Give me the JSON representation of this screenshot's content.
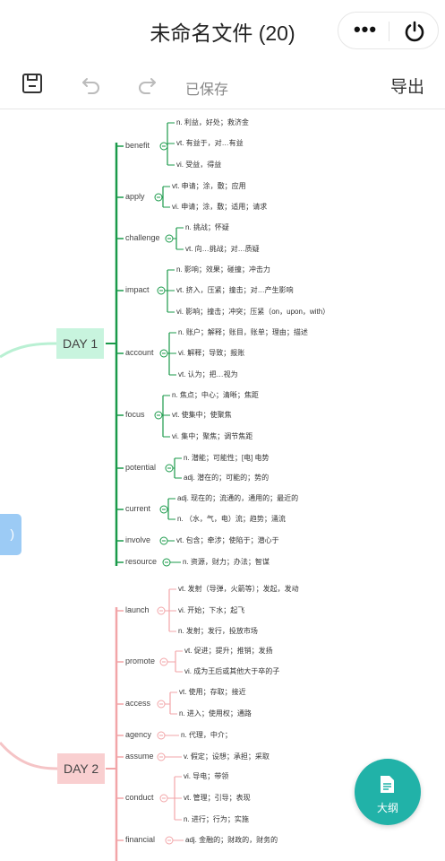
{
  "window": {
    "title": "未命名文件 (20)"
  },
  "toolbar": {
    "saved_label": "已保存",
    "export_label": "导出"
  },
  "fab": {
    "label": "大纲"
  },
  "colors": {
    "day1": "#1a9a4a",
    "day2": "#f2a5a8",
    "teal": "#21b2a8"
  },
  "mindmap": {
    "root_label": ")",
    "days": [
      {
        "label": "DAY 1",
        "words": [
          {
            "word": "benefit",
            "defs": [
              "n. 利益，好处；救济金",
              "vt. 有益于，对…有益",
              "vi. 受益，得益"
            ]
          },
          {
            "word": "apply",
            "defs": [
              "vt. 申请；涂，敷；应用",
              "vi. 申请；涂，敷；适用；请求"
            ]
          },
          {
            "word": "challenge",
            "defs": [
              "n. 挑战；怀疑",
              "vt. 向…挑战；对…质疑"
            ]
          },
          {
            "word": "impact",
            "defs": [
              "n. 影响；效果；碰撞；冲击力",
              "vt. 挤入，压紧；撞击；对…产生影响",
              "vi. 影响；撞击；冲突；压紧（on，upon，with）"
            ]
          },
          {
            "word": "account",
            "defs": [
              "n. 账户；解释；账目，账单；理由；描述",
              "vi. 解释；导致；报账",
              "vt. 认为；把…视为"
            ]
          },
          {
            "word": "focus",
            "defs": [
              "n. 焦点；中心；清晰；焦距",
              "vt. 使集中；使聚焦",
              "vi. 集中；聚焦；调节焦距"
            ]
          },
          {
            "word": "potential",
            "defs": [
              "n. 潜能；可能性；[电] 电势",
              "adj. 潜在的；可能的；势的"
            ]
          },
          {
            "word": "current",
            "defs": [
              "adj. 现在的；流通的，通用的；最近的",
              "n. （水，气，电）流；趋势；涌流"
            ]
          },
          {
            "word": "involve",
            "defs": [
              "vt. 包含；牵涉；使陷于；潜心于"
            ]
          },
          {
            "word": "resource",
            "defs": [
              "n. 资源，财力；办法；智谋"
            ]
          }
        ]
      },
      {
        "label": "DAY 2",
        "words": [
          {
            "word": "launch",
            "defs": [
              "vt. 发射（导弹，火箭等）；发起，发动",
              "vi. 开始；下水；起飞",
              "n. 发射；发行，投放市场"
            ]
          },
          {
            "word": "promote",
            "defs": [
              "vt. 促进；提升；推销；发扬",
              "vi. 成为王后或其他大于卒的子"
            ]
          },
          {
            "word": "access",
            "defs": [
              "vt. 使用；存取；接近",
              "n. 进入；使用权；通路"
            ]
          },
          {
            "word": "agency",
            "defs": [
              "n. 代理，中介；"
            ]
          },
          {
            "word": "assume",
            "defs": [
              "v. 假定；设想；承担；采取"
            ]
          },
          {
            "word": "conduct",
            "defs": [
              "vi. 导电；带领",
              "vt. 管理；引导；表现",
              "n. 进行；行为；实施"
            ]
          },
          {
            "word": "financial",
            "defs": [
              "adj. 金融的；财政的，财务的"
            ]
          }
        ]
      }
    ]
  }
}
